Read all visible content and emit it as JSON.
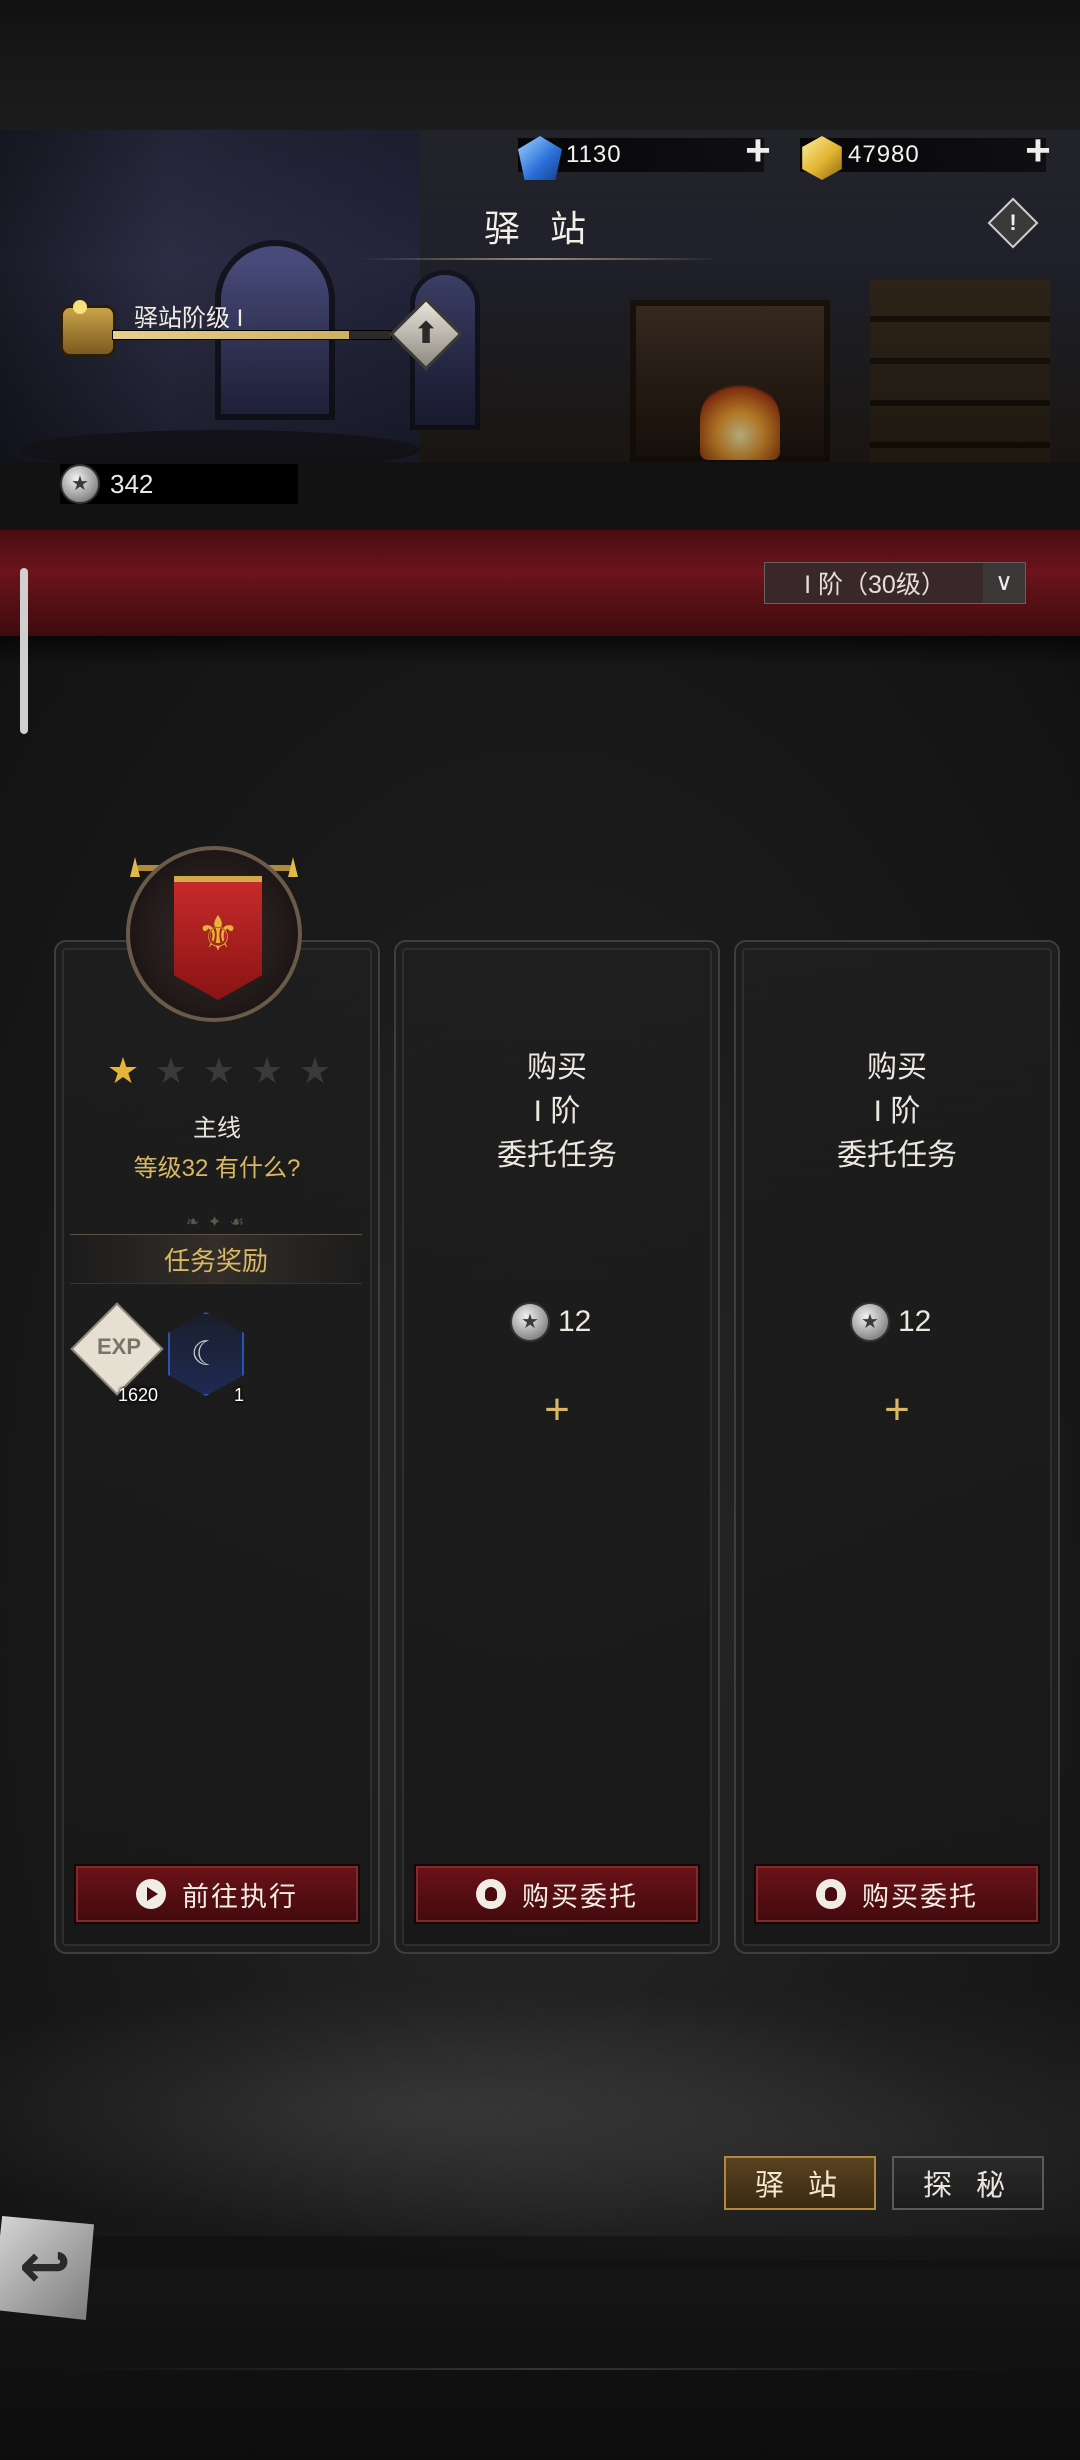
{
  "header": {
    "title": "驿 站",
    "diamond": "1130",
    "gold": "47980",
    "rank_label": "驿站阶级 I",
    "rank_progress": 0.85,
    "silver_coins": "342"
  },
  "tier_selector": {
    "label": "I 阶（30级）"
  },
  "cards": [
    {
      "category": "主线",
      "subtitle": "等级32 有什么?",
      "stars_filled": 1,
      "stars_total": 5,
      "rewards_title": "任务奖励",
      "rewards": [
        {
          "icon": "exp-icon",
          "label": "EXP",
          "qty": "1620"
        },
        {
          "icon": "scythe-icon",
          "qty": "1"
        }
      ],
      "button": "前往执行"
    },
    {
      "lines": [
        "购买",
        "I 阶",
        "委托任务"
      ],
      "price": "12",
      "button": "购买委托"
    },
    {
      "lines": [
        "购买",
        "I 阶",
        "委托任务"
      ],
      "price": "12",
      "button": "购买委托"
    }
  ],
  "tabs": {
    "station": "驿 站",
    "explore": "探 秘"
  },
  "colors": {
    "accent_gold": "#d9b765",
    "band_red": "#6b141b",
    "button_red": "#6b1218"
  }
}
